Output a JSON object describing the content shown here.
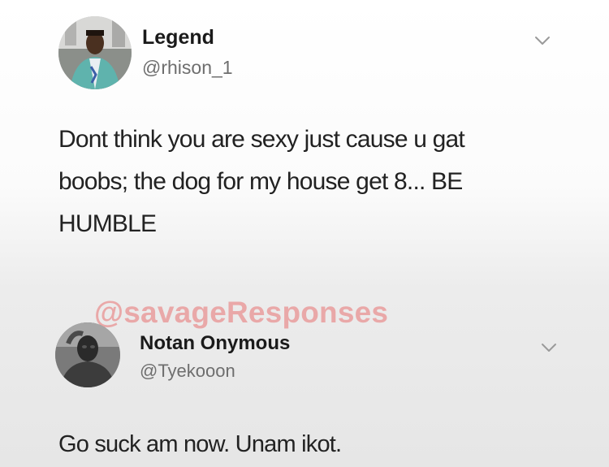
{
  "tweets": [
    {
      "display_name": "Legend",
      "handle": "@rhison_1",
      "text": "Dont think you are sexy just cause u gat\nboobs; the dog for my house get 8...  BE\nHUMBLE",
      "icons": {
        "avatar": "profile-photo-avatar",
        "menu": "chevron-down-icon"
      }
    },
    {
      "display_name": "Notan Onymous",
      "handle": "@Tyekooon",
      "text": "Go suck am now. Unam ikot.",
      "icons": {
        "avatar": "profile-photo-avatar",
        "menu": "chevron-down-icon"
      }
    }
  ],
  "watermark": "@savageResponses",
  "colors": {
    "watermark": "#e88080",
    "handle": "#6e6e6e",
    "text": "#222222"
  }
}
